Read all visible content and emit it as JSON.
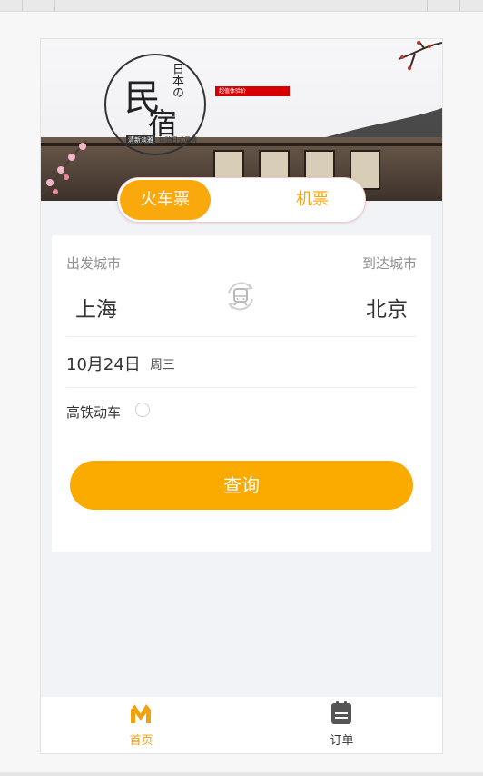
{
  "banner": {
    "title_main": "民",
    "title_main2": "宿",
    "title_side": "日本の",
    "tag": "超值体验价",
    "sub_tag_1": "清新淡雅",
    "sub_tag_2": "体验日式风情"
  },
  "tabs": [
    {
      "label": "火车票",
      "active": true
    },
    {
      "label": "机票",
      "active": false
    }
  ],
  "search": {
    "from_label": "出发城市",
    "to_label": "到达城市",
    "from_city": "上海",
    "to_city": "北京",
    "date": "10月24日",
    "weekday": "周三",
    "high_speed_label": "高铁动车",
    "high_speed_checked": false,
    "submit_label": "查询"
  },
  "bottom_nav": [
    {
      "label": "首页",
      "icon": "home-m-icon",
      "active": true
    },
    {
      "label": "订单",
      "icon": "orders-icon",
      "active": false
    }
  ],
  "colors": {
    "accent": "#fbaa00",
    "active_nav": "#f3a20f"
  }
}
